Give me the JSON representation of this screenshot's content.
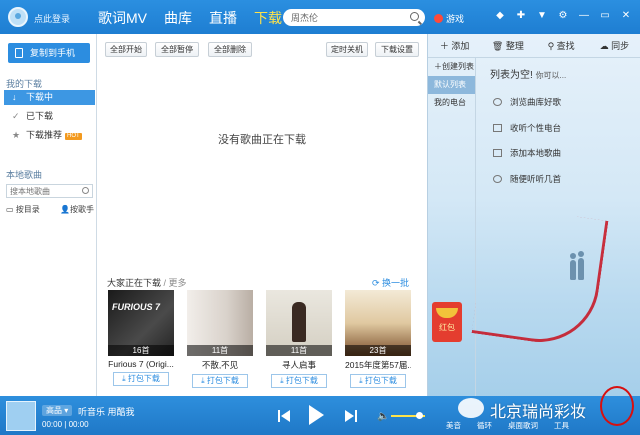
{
  "topbar": {
    "login": "点此登录",
    "nav": [
      "歌词MV",
      "曲库",
      "直播",
      "下载"
    ],
    "active_nav": 3,
    "search_value": "周杰伦",
    "game": "游戏",
    "window_icons": [
      "shield-icon",
      "skin-icon",
      "shirt-icon",
      "settings-icon",
      "minimize-icon",
      "maximize-icon",
      "close-icon"
    ]
  },
  "left": {
    "copy_button": "复制到手机",
    "section_my_download": "我的下载",
    "items": [
      {
        "label": "下载中",
        "icon": "arrow-down-icon"
      },
      {
        "label": "已下载",
        "icon": "check-icon"
      },
      {
        "label": "下载推荐",
        "icon": "star-icon",
        "badge": "HOT"
      }
    ],
    "section_local": "本地歌曲",
    "search_placeholder": "搜本地歌曲",
    "by_dir": "按目录",
    "by_singer": "按歌手"
  },
  "center": {
    "buttons": [
      "全部开始",
      "全部暂停",
      "全部删除",
      "定时关机",
      "下载设置"
    ],
    "empty_message": "没有歌曲正在下载",
    "rec_title": "大家正在下载",
    "rec_more": "/ 更多",
    "refresh": "换一批",
    "cards": [
      {
        "cover_text": "FURIOUS 7",
        "count": "16首",
        "title": "Furious 7 (Origi...",
        "button": "打包下载"
      },
      {
        "cover_text": "",
        "count": "11首",
        "title": "不散,不见",
        "button": "打包下载"
      },
      {
        "cover_text": "",
        "count": "11首",
        "title": "寻人启事",
        "button": "打包下载"
      },
      {
        "cover_text": "",
        "count": "23首",
        "title": "2015年度第57届...",
        "button": "打包下载"
      }
    ]
  },
  "right": {
    "tools": [
      "添加",
      "整理",
      "查找",
      "同步"
    ],
    "new_list": "创建列表",
    "default_list": "默认列表",
    "my_radio": "我的电台",
    "empty_title": "列表为空!",
    "empty_sub": "你可以...",
    "options": [
      "浏览曲库好歌",
      "收听个性电台",
      "添加本地歌曲",
      "随便听听几首"
    ],
    "redbag": "红包"
  },
  "player": {
    "quality": "高品",
    "title": "听音乐 用酷我",
    "time_current": "00:00",
    "time_total": "00:00",
    "volume_level": 0.85,
    "tools": [
      "美音",
      "循环",
      "桌面歌词",
      "工具"
    ]
  },
  "watermark": "北京瑞尚彩妆"
}
